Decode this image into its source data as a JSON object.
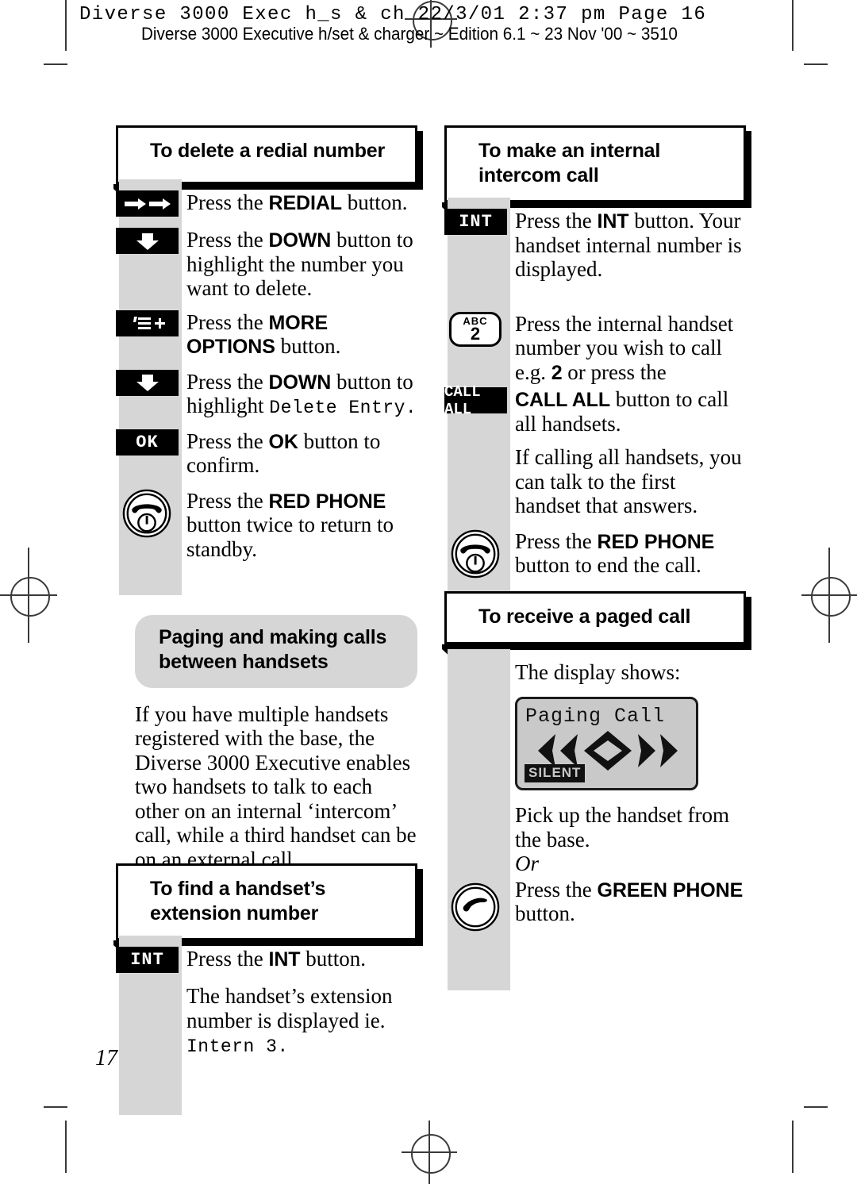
{
  "header": {
    "print_line": "Diverse 3000 Exec h_s & ch  22/3/01  2:37 pm  Page 16",
    "title_line": "Diverse 3000 Executive h/set & charger ~ Edition 6.1 ~ 23 Nov '00 ~ 3510"
  },
  "page_number": "17",
  "colors": {
    "rail_grey": "#d6d6d6",
    "key_black": "#000000",
    "lcd_grey": "#c9c9c9",
    "paper_white": "#ffffff"
  },
  "left_column": {
    "section_1": {
      "heading": "To delete a redial number",
      "steps": [
        {
          "key": "redial-icon",
          "key_label": "",
          "text_html": "Press the <b>REDIAL</b> button."
        },
        {
          "key": "down-arrow-icon",
          "key_label": "",
          "text_html": "Press the <b>DOWN</b> button to highlight the number you want to delete."
        },
        {
          "key": "more-options-icon",
          "key_label": "",
          "text_html": "Press the <b>MORE OPTIONS</b> button."
        },
        {
          "key": "down-arrow-icon",
          "key_label": "",
          "text_html": "Press the <b>DOWN</b> button to highlight <span class=\"lcdtext\">Delete Entry</span><span class=\"lcdtext\">.</span>"
        },
        {
          "key": "text-key",
          "key_label": "OK",
          "text_html": "Press the <b>OK</b> button to confirm."
        },
        {
          "key": "red-phone-icon",
          "key_label": "",
          "text_html": "Press the <b>RED PHONE</b> button twice to return to standby."
        }
      ]
    },
    "section_2": {
      "heading": "Paging and making calls between handsets",
      "body": "If you have multiple handsets registered with the base, the Diverse 3000 Executive enables two handsets to talk to each other on an internal ‘intercom’ call, while a third handset can be on an external call."
    },
    "section_3": {
      "heading": "To find a handset’s extension number",
      "steps": [
        {
          "key": "text-key",
          "key_label": "INT",
          "text_html": "Press the <b>INT</b> button."
        },
        {
          "key": "none",
          "key_label": "",
          "text_html": "The handset’s extension number is displayed ie. <span class=\"lcdtext\">Intern 3</span><span class=\"lcdtext\">.</span>"
        }
      ]
    }
  },
  "right_column": {
    "section_1": {
      "heading": "To make an internal intercom call",
      "steps": [
        {
          "key": "text-key",
          "key_label": "INT",
          "text_html": "Press the <b>INT</b> button. Your handset internal number is displayed."
        },
        {
          "key": "keypad-2-key",
          "key_label": "2",
          "key_sublabel": "ABC",
          "text_html": "Press the internal handset number you wish to call e.g. <b>2</b> or press the"
        },
        {
          "key": "text-key-wide",
          "key_label": "CALL ALL",
          "text_html": "<b>CALL ALL</b> button to call all handsets."
        },
        {
          "key": "none",
          "key_label": "",
          "text_html": "If calling all handsets, you can talk to the first handset that answers."
        },
        {
          "key": "red-phone-icon",
          "key_label": "",
          "text_html": "Press the <b>RED PHONE</b> button to end the call."
        }
      ]
    },
    "section_2": {
      "heading": "To receive a paged call",
      "intro": "The display shows:",
      "lcd": {
        "line1": "Paging Call",
        "animation": "ringing-chevrons-icon",
        "badge": "SILENT"
      },
      "steps": [
        {
          "key": "none",
          "key_label": "",
          "text_html": "Pick up the handset from the base."
        },
        {
          "key": "none",
          "key_label": "",
          "text_html": "<i>Or</i>"
        },
        {
          "key": "green-phone-icon",
          "key_label": "",
          "text_html": "Press the <b>GREEN PHONE</b> button."
        }
      ]
    }
  }
}
